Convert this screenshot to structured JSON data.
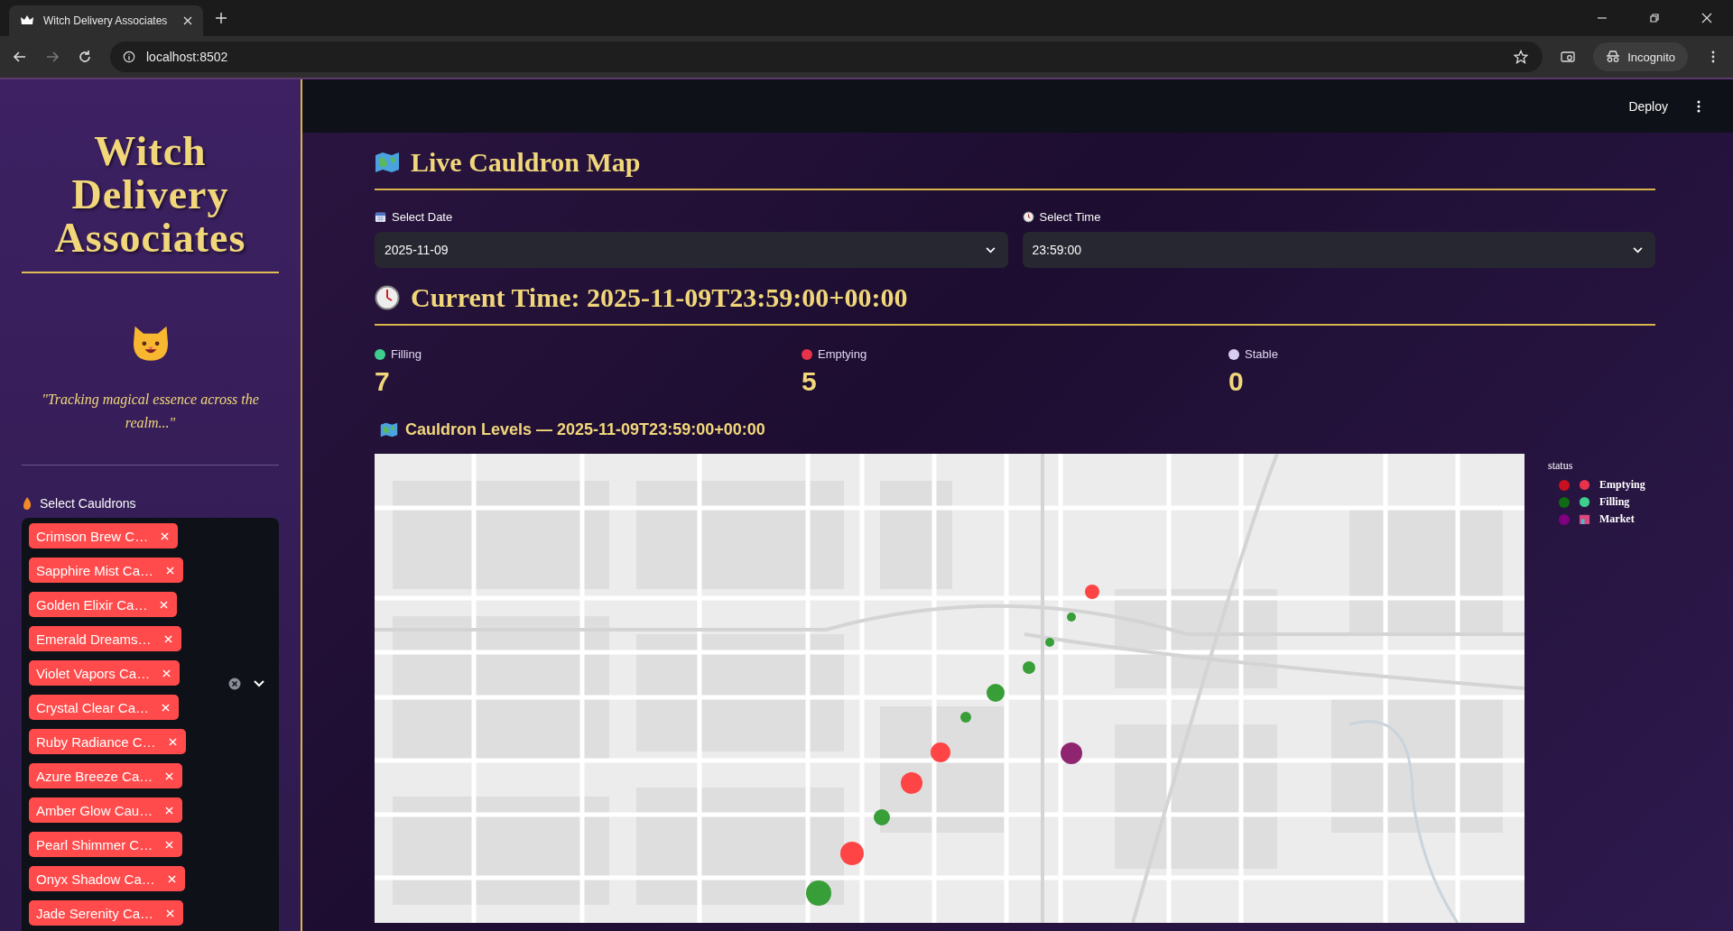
{
  "browser": {
    "tab_title": "Witch Delivery Associates",
    "url": "localhost:8502",
    "profile": "Incognito"
  },
  "sidebar": {
    "title": "Witch Delivery Associates",
    "tagline": "\"Tracking magical essence across the realm...\"",
    "select_label": "Select Cauldrons",
    "selected_cauldrons": [
      "Crimson Brew C…",
      "Sapphire Mist Ca…",
      "Golden Elixir Ca…",
      "Emerald Dreams…",
      "Violet Vapors Ca…",
      "Crystal Clear Ca…",
      "Ruby Radiance C…",
      "Azure Breeze Ca…",
      "Amber Glow Cau…",
      "Pearl Shimmer C…",
      "Onyx Shadow Ca…",
      "Jade Serenity Ca…"
    ]
  },
  "header": {
    "deploy": "Deploy"
  },
  "main": {
    "title": "Live Cauldron Map",
    "date_field": {
      "label": "Select Date",
      "value": "2025-11-09"
    },
    "time_field": {
      "label": "Select Time",
      "value": "23:59:00"
    },
    "current_time": "Current Time: 2025-11-09T23:59:00+00:00",
    "metrics": [
      {
        "label": "Filling",
        "value": "7",
        "color": "#3ecf8e"
      },
      {
        "label": "Emptying",
        "value": "5",
        "color": "#e8334a"
      },
      {
        "label": "Stable",
        "value": "0",
        "color": "#d9cdf0"
      }
    ],
    "map_title": "Cauldron Levels — 2025-11-09T23:59:00+00:00",
    "map": {
      "kind": "picture",
      "markers": [
        {
          "kind": "emptying"
        },
        {
          "kind": "filling"
        },
        {
          "kind": "filling"
        },
        {
          "kind": "filling"
        },
        {
          "kind": "filling"
        },
        {
          "kind": "filling"
        },
        {
          "kind": "market"
        },
        {
          "kind": "emptying"
        },
        {
          "kind": "emptying"
        },
        {
          "kind": "filling"
        },
        {
          "kind": "emptying"
        },
        {
          "kind": "filling"
        }
      ]
    },
    "legend": {
      "title": "status",
      "items": [
        {
          "label": "Emptying",
          "kind": "emptying",
          "color": "#c8101e"
        },
        {
          "label": "Filling",
          "kind": "filling",
          "color": "#0f6b14"
        },
        {
          "label": "Market",
          "kind": "market",
          "color": "#800080"
        }
      ]
    }
  }
}
